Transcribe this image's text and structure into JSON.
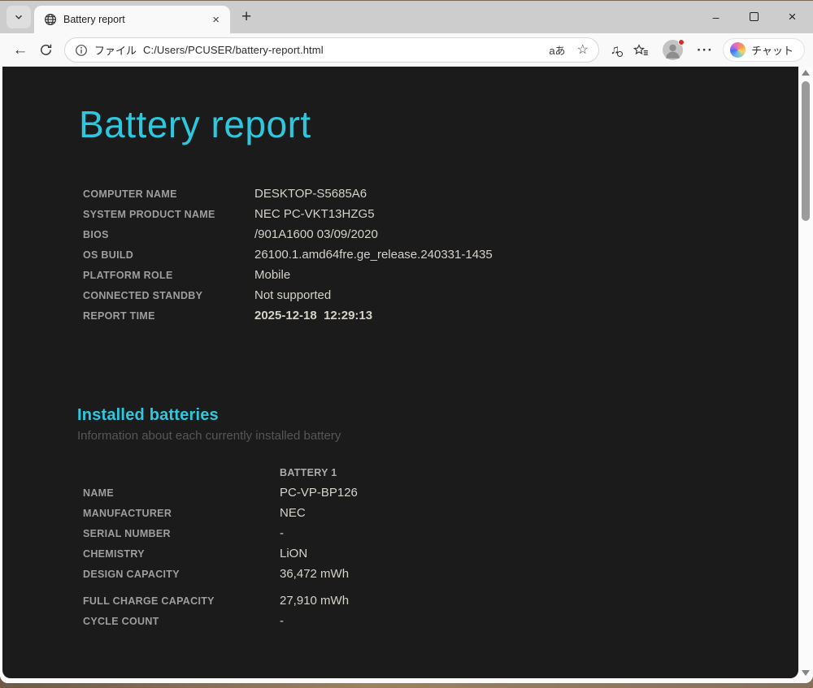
{
  "browser": {
    "tab_title": "Battery report",
    "icons": {
      "tab_close": "×",
      "new_tab": "+",
      "minimize": "–",
      "window_close": "×",
      "back_arrow": "←",
      "star": "☆",
      "media_note": "♫",
      "more_dots": "···"
    },
    "address": {
      "scheme_label": "ファイル",
      "url": "C:/Users/PCUSER/battery-report.html",
      "translate_glyph": "aあ"
    },
    "copilot_label": "チャット"
  },
  "report": {
    "title": "Battery report",
    "info": [
      {
        "label": "COMPUTER NAME",
        "value": "DESKTOP-S5685A6"
      },
      {
        "label": "SYSTEM PRODUCT NAME",
        "value": "NEC PC-VKT13HZG5"
      },
      {
        "label": "BIOS",
        "value": "/901A1600 03/09/2020"
      },
      {
        "label": "OS BUILD",
        "value": "26100.1.amd64fre.ge_release.240331-1435"
      },
      {
        "label": "PLATFORM ROLE",
        "value": "Mobile"
      },
      {
        "label": "CONNECTED STANDBY",
        "value": "Not supported"
      },
      {
        "label": "REPORT TIME",
        "value": "2025-12-18  12:29:13"
      }
    ],
    "installed": {
      "heading": "Installed batteries",
      "subtitle": "Information about each currently installed battery",
      "column_header": "BATTERY 1",
      "rows": [
        {
          "label": "NAME",
          "value": "PC-VP-BP126"
        },
        {
          "label": "MANUFACTURER",
          "value": "NEC"
        },
        {
          "label": "SERIAL NUMBER",
          "value": "-"
        },
        {
          "label": "CHEMISTRY",
          "value": "LiON"
        },
        {
          "label": "DESIGN CAPACITY",
          "value": "36,472 mWh"
        },
        {
          "label": "FULL CHARGE CAPACITY",
          "value": "27,910 mWh"
        },
        {
          "label": "CYCLE COUNT",
          "value": "-"
        }
      ]
    }
  },
  "colors": {
    "accent_cyan": "#2ec8de",
    "page_background": "#1b1b1b",
    "label_gray": "#9e9e9e",
    "value_gray": "#d5d2ca",
    "titlebar_gray": "#cdcdcd",
    "notification_red": "#d92b2b"
  }
}
